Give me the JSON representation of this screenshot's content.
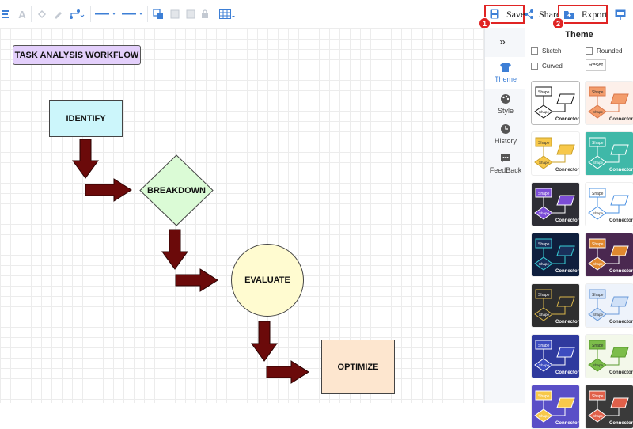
{
  "toolbar": {
    "save_label": "Save",
    "share_label": "Share",
    "export_label": "Export",
    "badge_save": "1",
    "badge_export": "2"
  },
  "diagram": {
    "title": "TASK ANALYSIS WORKFLOW",
    "nodes": [
      {
        "label": "IDENTIFY",
        "shape": "rectangle",
        "fill": "#ccf6fb"
      },
      {
        "label": "BREAKDOWN",
        "shape": "diamond",
        "fill": "#dbfbd6"
      },
      {
        "label": "EVALUATE",
        "shape": "circle",
        "fill": "#fffbd0"
      },
      {
        "label": "OPTIMIZE",
        "shape": "rectangle",
        "fill": "#fde6cf"
      }
    ],
    "arrow_color": "#6b0a0a"
  },
  "rail": {
    "items": [
      {
        "label": "Theme",
        "icon": "shirt-icon"
      },
      {
        "label": "Style",
        "icon": "palette-icon"
      },
      {
        "label": "History",
        "icon": "clock-icon"
      },
      {
        "label": "FeedBack",
        "icon": "chat-icon"
      }
    ]
  },
  "panel": {
    "title": "Theme",
    "sketch_label": "Sketch",
    "rounded_label": "Rounded",
    "curved_label": "Curved",
    "reset_label": "Reset",
    "theme_shape_label": "Shape",
    "theme_connector_label": "Connector",
    "themes": [
      {
        "bg": "#ffffff",
        "shape": "#ffffff",
        "stroke": "#111111",
        "text": "#111111",
        "selected": true
      },
      {
        "bg": "#fdf0ea",
        "shape": "#f39c6b",
        "stroke": "#d9764a",
        "text": "#333333",
        "selected": false
      },
      {
        "bg": "#ffffff",
        "shape": "#f7c84a",
        "stroke": "#caa12a",
        "text": "#333333",
        "selected": false
      },
      {
        "bg": "#3fb8a8",
        "shape": "#3fb8a8",
        "stroke": "#ffffff",
        "text": "#ffffff",
        "selected": false
      },
      {
        "bg": "#2e2e35",
        "shape": "#7c4dd6",
        "stroke": "#ffffff",
        "text": "#ffffff",
        "selected": false
      },
      {
        "bg": "#ffffff",
        "shape": "#ffffff",
        "stroke": "#4a90e2",
        "text": "#333333",
        "selected": false
      },
      {
        "bg": "#0f1f3d",
        "shape": "#1a2f5a",
        "stroke": "#38d1d8",
        "text": "#ffffff",
        "selected": false
      },
      {
        "bg": "#4a2850",
        "shape": "#e0892f",
        "stroke": "#ffffff",
        "text": "#ffffff",
        "selected": false
      },
      {
        "bg": "#2e2e2e",
        "shape": "#2e2e2e",
        "stroke": "#d9b64a",
        "text": "#ffffff",
        "selected": false
      },
      {
        "bg": "#eef3fb",
        "shape": "#cfe0f7",
        "stroke": "#6a9ad8",
        "text": "#333333",
        "selected": false
      },
      {
        "bg": "#2f3a9e",
        "shape": "#3d4cc0",
        "stroke": "#ffffff",
        "text": "#ffffff",
        "selected": false
      },
      {
        "bg": "#f3f8ea",
        "shape": "#7cbd4a",
        "stroke": "#5a9a2e",
        "text": "#333333",
        "selected": false
      },
      {
        "bg": "#5a4fc7",
        "shape": "#f7c84a",
        "stroke": "#ffffff",
        "text": "#ffffff",
        "selected": false
      },
      {
        "bg": "#3a3a3a",
        "shape": "#e0604a",
        "stroke": "#ffffff",
        "text": "#ffffff",
        "selected": false
      }
    ]
  }
}
